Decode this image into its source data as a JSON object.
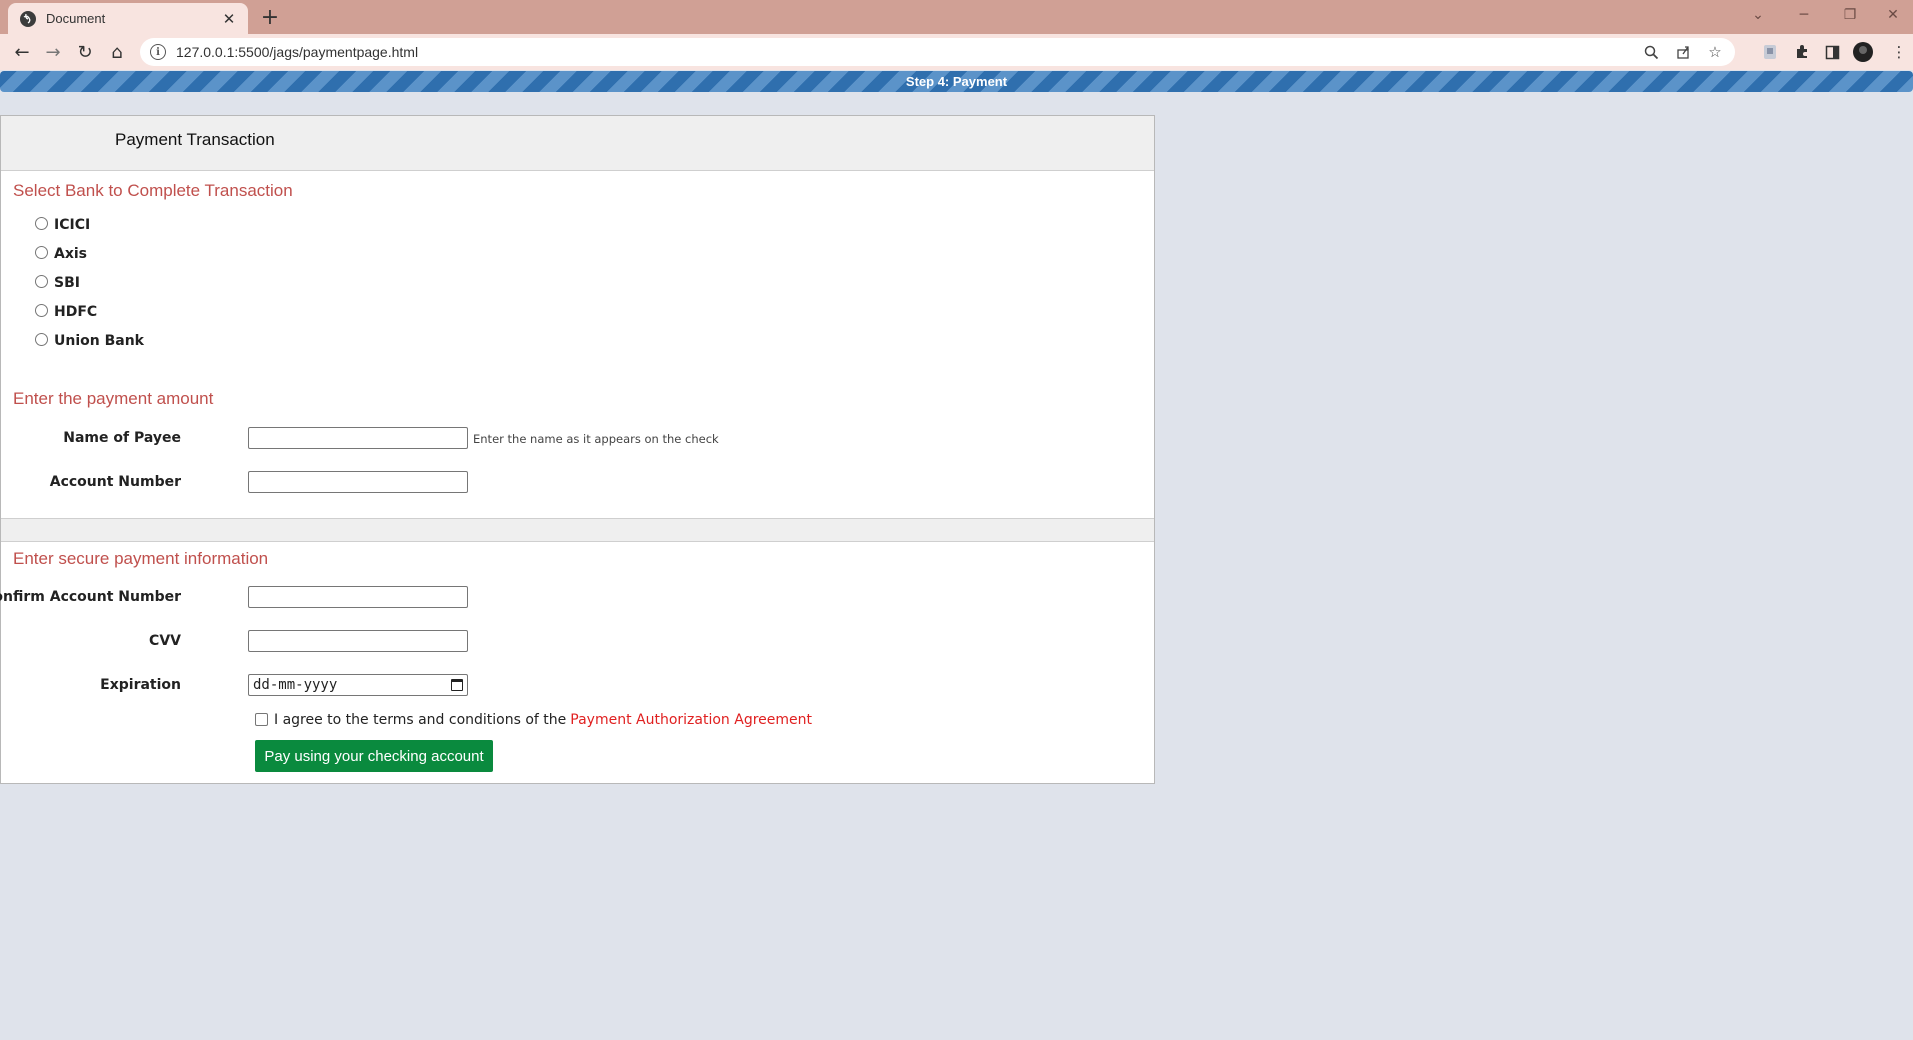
{
  "browser": {
    "tab_title": "Document",
    "url": "127.0.0.1:5500/jags/paymentpage.html"
  },
  "page": {
    "step_label": "Step 4: Payment",
    "card_title": "Payment Transaction",
    "bank_section": {
      "title": "Select Bank to Complete Transaction",
      "banks": [
        "ICICI",
        "Axis",
        "SBI",
        "HDFC",
        "Union Bank"
      ]
    },
    "amount_section": {
      "title": "Enter the payment amount",
      "payee_label": "Name of Payee",
      "payee_value": "",
      "payee_hint": "Enter the name as it appears on the check",
      "account_label": "Account Number",
      "account_value": ""
    },
    "secure_section": {
      "title": "Enter secure payment information",
      "confirm_label": "Confirm Account Number",
      "confirm_value": "",
      "cvv_label": "CVV",
      "cvv_value": "",
      "expiration_label": "Expiration",
      "expiration_placeholder": "dd-mm-yyyy",
      "agree_text": "I agree to the terms and conditions of the",
      "agree_link": "Payment Authorization Agreement",
      "agree_checked": false,
      "pay_button": "Pay using your checking account"
    }
  },
  "colors": {
    "section_title": "#c0504d",
    "pay_button": "#0a8a3e",
    "link": "#e02020",
    "step_bar": "#2f6fae"
  }
}
